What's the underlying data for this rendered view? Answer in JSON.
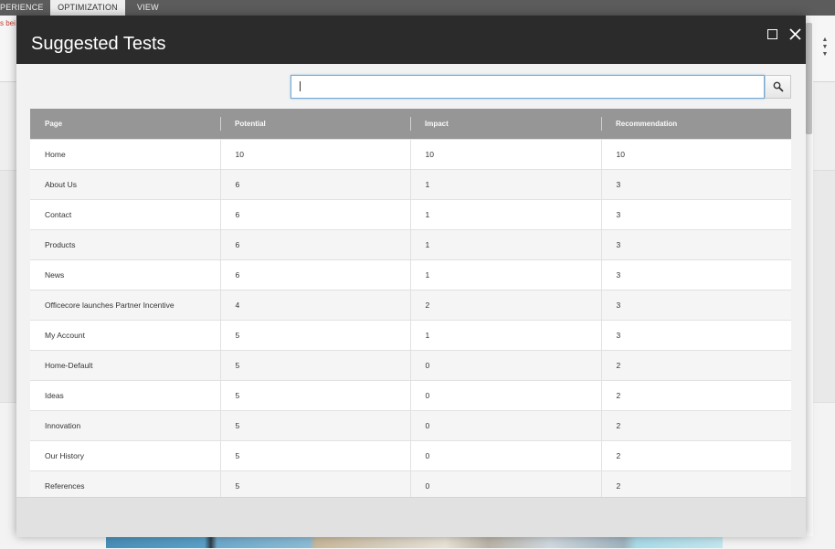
{
  "ribbon": {
    "tabs": [
      {
        "label": "PERIENCE"
      },
      {
        "label": "OPTIMIZATION"
      },
      {
        "label": "VIEW"
      }
    ],
    "message_fragment": "s bei"
  },
  "dialog": {
    "title": "Suggested Tests",
    "search": {
      "value": "",
      "placeholder": ""
    },
    "columns": [
      "Page",
      "Potential",
      "Impact",
      "Recommendation"
    ],
    "rows": [
      [
        "Home",
        "10",
        "10",
        "10"
      ],
      [
        "About Us",
        "6",
        "1",
        "3"
      ],
      [
        "Contact",
        "6",
        "1",
        "3"
      ],
      [
        "Products",
        "6",
        "1",
        "3"
      ],
      [
        "News",
        "6",
        "1",
        "3"
      ],
      [
        "Officecore launches Partner Incentive",
        "4",
        "2",
        "3"
      ],
      [
        "My Account",
        "5",
        "1",
        "3"
      ],
      [
        "Home-Default",
        "5",
        "0",
        "2"
      ],
      [
        "Ideas",
        "5",
        "0",
        "2"
      ],
      [
        "Innovation",
        "5",
        "0",
        "2"
      ],
      [
        "Our History",
        "5",
        "0",
        "2"
      ],
      [
        "References",
        "5",
        "0",
        "2"
      ]
    ]
  },
  "icons": {
    "maximize": "maximize-icon",
    "close": "close-icon",
    "search": "search-icon"
  },
  "colors": {
    "header_bg": "#2b2b2b",
    "table_header_bg": "#969696",
    "input_focus": "#6fa9d8"
  }
}
